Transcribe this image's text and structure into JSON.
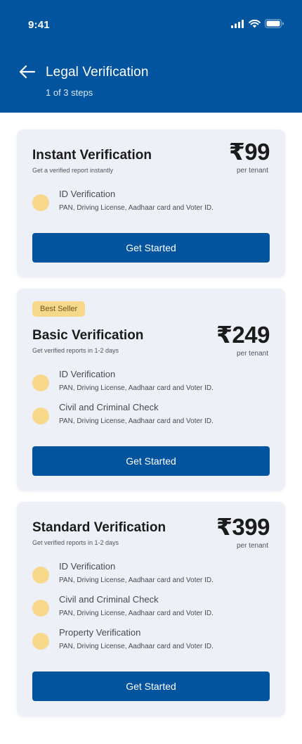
{
  "status_bar": {
    "time": "9:41"
  },
  "header": {
    "title": "Legal Verification",
    "subtitle": "1 of 3 steps"
  },
  "colors": {
    "primary": "#02549f",
    "card_background": "#eef0f8",
    "accent_yellow": "#f8d98c"
  },
  "icons": [
    "back-arrow-icon",
    "signal-icon",
    "wifi-icon",
    "battery-icon"
  ],
  "plans": [
    {
      "title": "Instant Verification",
      "description": "Get a verified report instantly",
      "price": "₹99",
      "price_unit": "per tenant",
      "features": [
        {
          "name": "ID Verification",
          "details": "PAN, Driving License, Aadhaar card and Voter ID."
        }
      ],
      "cta": "Get Started"
    },
    {
      "badge": "Best Seller",
      "title": "Basic Verification",
      "description": "Get verified reports in 1-2 days",
      "price": "₹249",
      "price_unit": "per tenant",
      "features": [
        {
          "name": "ID Verification",
          "details": "PAN, Driving License, Aadhaar card and Voter ID."
        },
        {
          "name": "Civil and Criminal Check",
          "details": "PAN, Driving License, Aadhaar card and Voter ID."
        }
      ],
      "cta": "Get Started"
    },
    {
      "title": "Standard Verification",
      "description": "Get verified reports in 1-2 days",
      "price": "₹399",
      "price_unit": "per tenant",
      "features": [
        {
          "name": "ID Verification",
          "details": "PAN, Driving License, Aadhaar card and Voter ID."
        },
        {
          "name": "Civil and Criminal Check",
          "details": "PAN, Driving License, Aadhaar card and Voter ID."
        },
        {
          "name": "Property Verification",
          "details": "PAN, Driving License, Aadhaar card and Voter ID."
        }
      ],
      "cta": "Get Started"
    }
  ]
}
